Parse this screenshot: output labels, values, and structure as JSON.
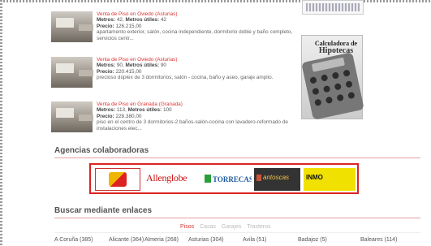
{
  "listings": [
    {
      "title": "Venta de Piso en Oviedo (Asturias)",
      "size_label": "Metros:",
      "size": "42,",
      "useful_label": "Metros útiles:",
      "useful": "42",
      "price_label": "Precio:",
      "price": "126.215,00",
      "desc": "apartamento exterior, salón, cocina independiente, dormitorio doble y baño completo, servicios centr..."
    },
    {
      "title": "Venta de Piso en Oviedo (Asturias)",
      "size_label": "Metros:",
      "size": "90,",
      "useful_label": "Metros útiles:",
      "useful": "90",
      "price_label": "Precio:",
      "price": "220.415,00",
      "desc": "precioso dúplex de 3 dormitorios, salón - cocina, baño y aseo, garaje amplio."
    },
    {
      "title": "Venta de Piso en Granada (Granada)",
      "size_label": "Metros:",
      "size": "113,",
      "useful_label": "Metros útiles:",
      "useful": "100",
      "price_label": "Precio:",
      "price": "228.380,00",
      "desc": "piso en el centro de 3 dormitorios-2 baños-salón-cocina con lavadero-reformado de instalaciones elec..."
    }
  ],
  "agencies": {
    "title": "Agencias colaboradoras",
    "logos": [
      {
        "name": "agency-logo-a",
        "text": ""
      },
      {
        "name": "agency-logo-allenglobe",
        "text": "Allenglobe"
      },
      {
        "name": "agency-logo-torrecasa",
        "text": "TORRECASA"
      },
      {
        "name": "agency-logo-antoscas",
        "text": "antoscas"
      },
      {
        "name": "agency-logo-inmo",
        "text": "INMO"
      }
    ]
  },
  "links": {
    "title": "Buscar mediante enlaces",
    "tabs": [
      "Pisos",
      "Casas",
      "Garajes",
      "Trasteros"
    ],
    "active_tab": "Pisos",
    "items": [
      "A Coruña (385)",
      "Alicante (364)",
      "Almeria (268)",
      "Asturias (304)",
      "Avila (51)",
      "Badajoz (5)",
      "Baleares (114)"
    ]
  },
  "sidebar": {
    "calc_line1": "Calculadora de",
    "calc_line2": "Hipotecas"
  },
  "colors": {
    "accent": "#dd2222",
    "title_red": "#d33333",
    "rule": "#e7a0a0"
  }
}
